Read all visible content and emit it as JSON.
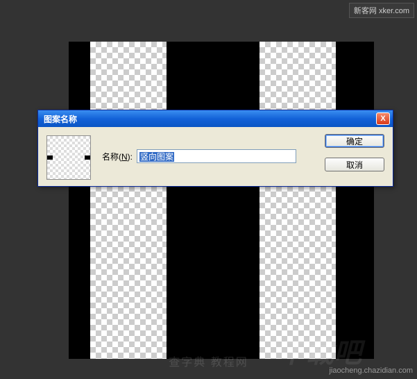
{
  "header_badge": "新客网 xker.com",
  "dialog": {
    "title": "图案名称",
    "name_label_pre": "名称(",
    "name_label_u": "N",
    "name_label_post": "):",
    "name_value": "竖向图案",
    "ok_label": "确定",
    "cancel_label": "取消",
    "close_label": "X"
  },
  "wm": {
    "bottom_right": "jiaocheng.chazidian.com",
    "center": "查字典 教程网",
    "big": "下载吧"
  }
}
